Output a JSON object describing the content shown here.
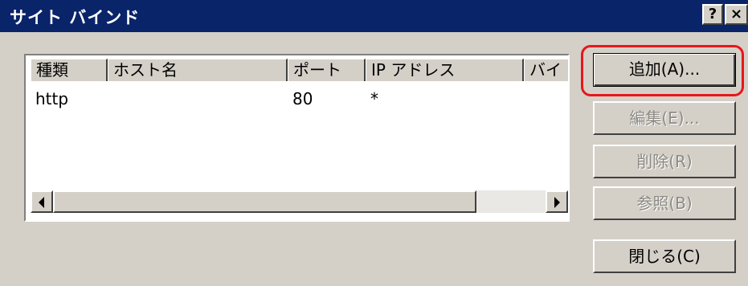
{
  "window": {
    "title": "サイト バインド",
    "help_glyph": "?",
    "close_glyph": "×"
  },
  "bindings_list": {
    "columns": [
      "種類",
      "ホスト名",
      "ポート",
      "IP アドレス",
      "バイ"
    ],
    "rows": [
      {
        "type": "http",
        "host": "",
        "port": "80",
        "ip": "*"
      }
    ]
  },
  "buttons": {
    "add": "追加(A)...",
    "edit": "編集(E)...",
    "delete": "削除(R)",
    "browse": "参照(B)",
    "close": "閉じる(C)"
  },
  "states": {
    "edit_enabled": false,
    "delete_enabled": false,
    "browse_enabled": false
  },
  "highlight": {
    "target": "add-button",
    "color": "#e8161b"
  },
  "colors": {
    "titlebar": "#0a246a",
    "face": "#d4d0c8"
  }
}
